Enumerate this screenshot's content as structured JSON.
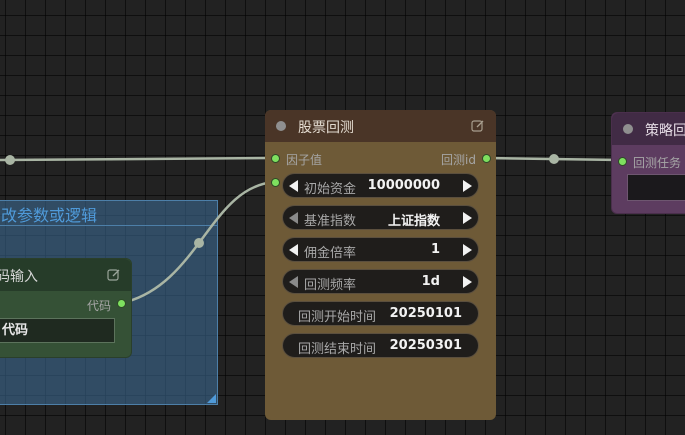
{
  "group": {
    "title": "改参数或逻辑"
  },
  "code_node": {
    "title": "码输入",
    "output_label": "代码",
    "field_value": "代码"
  },
  "backtest_node": {
    "title": "股票回测",
    "input_label": "因子值",
    "output_label": "回测id",
    "widgets": [
      {
        "label": "初始资金",
        "value": "10000000",
        "type": "number"
      },
      {
        "label": "基准指数",
        "value": "上证指数",
        "type": "combo"
      },
      {
        "label": "佣金倍率",
        "value": "1",
        "type": "number"
      },
      {
        "label": "回测频率",
        "value": "1d",
        "type": "combo"
      },
      {
        "label": "回测开始时间",
        "value": "20250101",
        "type": "text"
      },
      {
        "label": "回测结束时间",
        "value": "20250301",
        "type": "text"
      }
    ]
  },
  "strategy_node": {
    "title": "策略回",
    "input_label": "回测任务"
  },
  "colors": {
    "canvas": "#222222",
    "wire": "#a9b5a4",
    "slot_connected": "#7ee05f",
    "group": "#3a668c",
    "code_node": "#355136",
    "backtest_node": "#6e5a37",
    "strategy_node": "#5d3c60"
  }
}
